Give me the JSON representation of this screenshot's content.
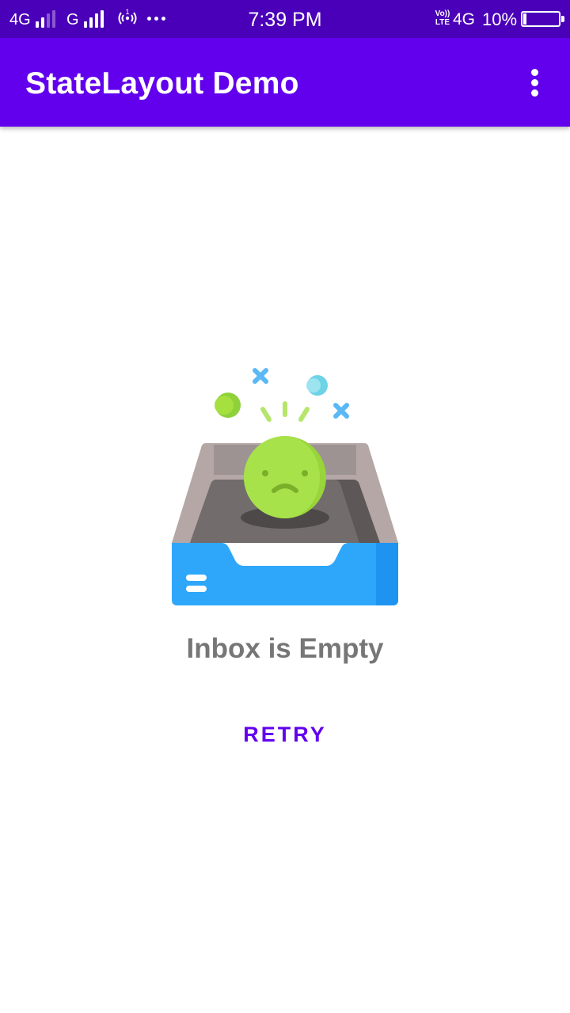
{
  "status_bar": {
    "network_1": "4G",
    "network_2": "G",
    "time": "7:39 PM",
    "volte_label": "Vo)) LTE",
    "network_right": "4G",
    "battery_percent": "10%",
    "battery_level": 0.1
  },
  "app_bar": {
    "title": "StateLayout Demo",
    "overflow_icon": "more-vert-icon"
  },
  "empty_state": {
    "illustration": "empty-inbox-sad-face",
    "message": "Inbox is Empty",
    "retry_label": "RETRY"
  },
  "colors": {
    "status_bar": "#4a00b8",
    "primary": "#6200ee",
    "message_text": "#767676",
    "tray_blue": "#2ea7fb",
    "face_green": "#a6e03f"
  }
}
